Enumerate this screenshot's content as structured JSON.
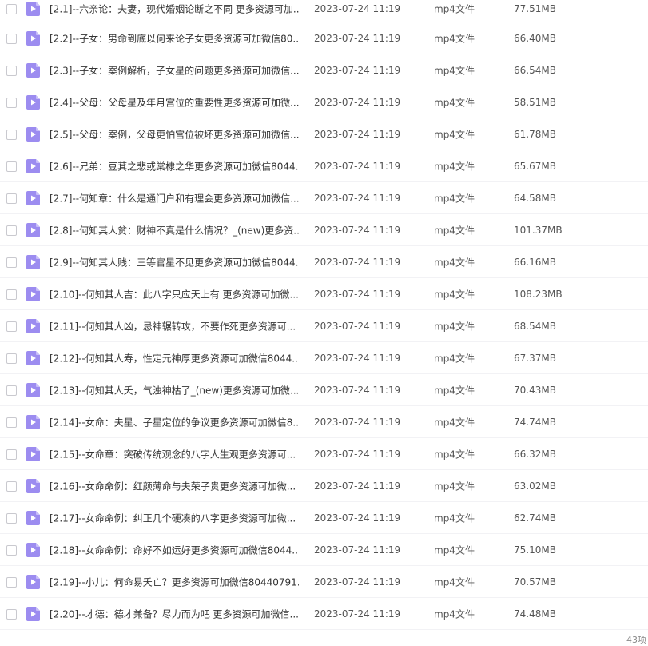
{
  "files": [
    {
      "name": "[2.1]--六亲论：夫妻，现代婚姻论断之不同 更多资源可加...",
      "date": "2023-07-24 11:19",
      "type": "mp4文件",
      "size": "77.51MB"
    },
    {
      "name": "[2.2]--子女：男命到底以何来论子女更多资源可加微信80...",
      "date": "2023-07-24 11:19",
      "type": "mp4文件",
      "size": "66.40MB"
    },
    {
      "name": "[2.3]--子女：案例解析，子女星的问题更多资源可加微信...",
      "date": "2023-07-24 11:19",
      "type": "mp4文件",
      "size": "66.54MB"
    },
    {
      "name": "[2.4]--父母：父母星及年月宫位的重要性更多资源可加微...",
      "date": "2023-07-24 11:19",
      "type": "mp4文件",
      "size": "58.51MB"
    },
    {
      "name": "[2.5]--父母：案例，父母更怕宫位被坏更多资源可加微信...",
      "date": "2023-07-24 11:19",
      "type": "mp4文件",
      "size": "61.78MB"
    },
    {
      "name": "[2.6]--兄弟：豆萁之悲或棠棣之华更多资源可加微信8044...",
      "date": "2023-07-24 11:19",
      "type": "mp4文件",
      "size": "65.67MB"
    },
    {
      "name": "[2.7]--何知章：什么是通门户和有理会更多资源可加微信...",
      "date": "2023-07-24 11:19",
      "type": "mp4文件",
      "size": "64.58MB"
    },
    {
      "name": "[2.8]--何知其人贫：财神不真是什么情况？_(new)更多资...",
      "date": "2023-07-24 11:19",
      "type": "mp4文件",
      "size": "101.37MB"
    },
    {
      "name": "[2.9]--何知其人贱：三等官星不见更多资源可加微信8044...",
      "date": "2023-07-24 11:19",
      "type": "mp4文件",
      "size": "66.16MB"
    },
    {
      "name": "[2.10]--何知其人吉：此八字只应天上有 更多资源可加微...",
      "date": "2023-07-24 11:19",
      "type": "mp4文件",
      "size": "108.23MB"
    },
    {
      "name": "[2.11]--何知其人凶，忌神辗转攻，不要作死更多资源可...",
      "date": "2023-07-24 11:19",
      "type": "mp4文件",
      "size": "68.54MB"
    },
    {
      "name": "[2.12]--何知其人寿，性定元神厚更多资源可加微信8044...",
      "date": "2023-07-24 11:19",
      "type": "mp4文件",
      "size": "67.37MB"
    },
    {
      "name": "[2.13]--何知其人夭，气浊神枯了_(new)更多资源可加微...",
      "date": "2023-07-24 11:19",
      "type": "mp4文件",
      "size": "70.43MB"
    },
    {
      "name": "[2.14]--女命：夫星、子星定位的争议更多资源可加微信8...",
      "date": "2023-07-24 11:19",
      "type": "mp4文件",
      "size": "74.74MB"
    },
    {
      "name": "[2.15]--女命章：突破传统观念的八字人生观更多资源可...",
      "date": "2023-07-24 11:19",
      "type": "mp4文件",
      "size": "66.32MB"
    },
    {
      "name": "[2.16]--女命命例：红颜薄命与夫荣子贵更多资源可加微...",
      "date": "2023-07-24 11:19",
      "type": "mp4文件",
      "size": "63.02MB"
    },
    {
      "name": "[2.17]--女命命例：纠正几个硬凑的八字更多资源可加微...",
      "date": "2023-07-24 11:19",
      "type": "mp4文件",
      "size": "62.74MB"
    },
    {
      "name": "[2.18]--女命命例：命好不如运好更多资源可加微信8044...",
      "date": "2023-07-24 11:19",
      "type": "mp4文件",
      "size": "75.10MB"
    },
    {
      "name": "[2.19]--小儿：何命易夭亡？更多资源可加微信80440791...",
      "date": "2023-07-24 11:19",
      "type": "mp4文件",
      "size": "70.57MB"
    },
    {
      "name": "[2.20]--才德：德才兼备？尽力而为吧 更多资源可加微信...",
      "date": "2023-07-24 11:19",
      "type": "mp4文件",
      "size": "74.48MB"
    }
  ],
  "footer": {
    "count": "43项"
  },
  "colors": {
    "icon_bg": "#9c8cf0",
    "icon_play": "#ffffff"
  }
}
